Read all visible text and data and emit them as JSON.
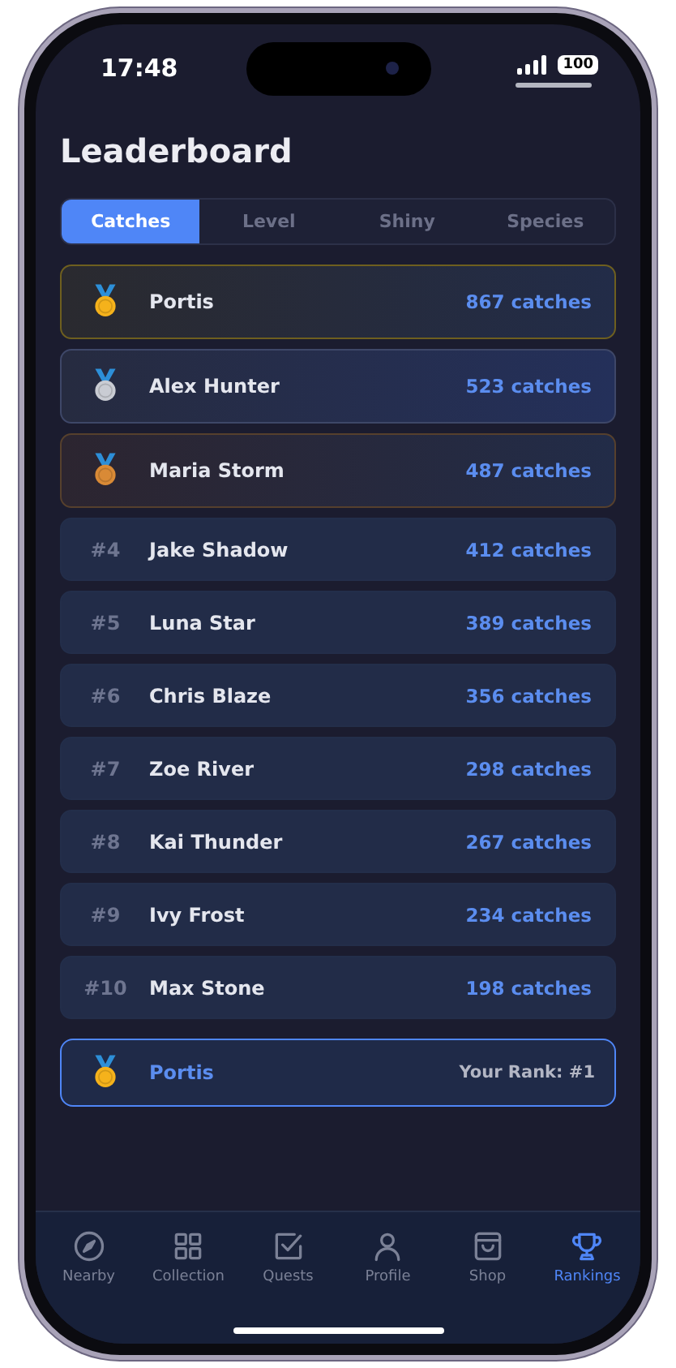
{
  "status_bar": {
    "time": "17:48",
    "battery": "100"
  },
  "title": "Leaderboard",
  "tabs": [
    {
      "label": "Catches",
      "selected": true
    },
    {
      "label": "Level",
      "selected": false
    },
    {
      "label": "Shiny",
      "selected": false
    },
    {
      "label": "Species",
      "selected": false
    }
  ],
  "rows": [
    {
      "kind": "medal",
      "color": "#f5b21b",
      "name": "Portis",
      "score": "867 catches"
    },
    {
      "kind": "medal",
      "color": "#c9ccd3",
      "name": "Alex Hunter",
      "score": "523 catches"
    },
    {
      "kind": "medal",
      "color": "#d98a36",
      "name": "Maria Storm",
      "score": "487 catches"
    },
    {
      "kind": "rank",
      "rank": "#4",
      "name": "Jake Shadow",
      "score": "412 catches"
    },
    {
      "kind": "rank",
      "rank": "#5",
      "name": "Luna Star",
      "score": "389 catches"
    },
    {
      "kind": "rank",
      "rank": "#6",
      "name": "Chris Blaze",
      "score": "356 catches"
    },
    {
      "kind": "rank",
      "rank": "#7",
      "name": "Zoe River",
      "score": "298 catches"
    },
    {
      "kind": "rank",
      "rank": "#8",
      "name": "Kai Thunder",
      "score": "267 catches"
    },
    {
      "kind": "rank",
      "rank": "#9",
      "name": "Ivy Frost",
      "score": "234 catches"
    },
    {
      "kind": "rank",
      "rank": "#10",
      "name": "Max Stone",
      "score": "198 catches"
    }
  ],
  "your_rank": {
    "color": "#f5b21b",
    "name": "Portis",
    "rank": "Your Rank: #1"
  },
  "nav": [
    {
      "label": "Nearby",
      "selected": false
    },
    {
      "label": "Collection",
      "selected": false
    },
    {
      "label": "Quests",
      "selected": false
    },
    {
      "label": "Profile",
      "selected": false
    },
    {
      "label": "Shop",
      "selected": false
    },
    {
      "label": "Rankings",
      "selected": true
    }
  ]
}
